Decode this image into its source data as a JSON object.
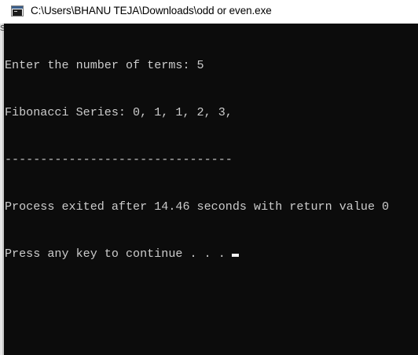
{
  "window": {
    "title": "C:\\Users\\BHANU TEJA\\Downloads\\odd or even.exe",
    "icon": "console-app-icon"
  },
  "console": {
    "lines": [
      "Enter the number of terms: 5",
      "Fibonacci Series: 0, 1, 1, 2, 3,",
      "--------------------------------",
      "Process exited after 14.46 seconds with return value 0",
      "Press any key to continue . . ."
    ]
  },
  "colors": {
    "console_background": "#0c0c0c",
    "console_text": "#cccccc",
    "titlebar_background": "#ffffff",
    "cursor": "#f2f2f2"
  }
}
